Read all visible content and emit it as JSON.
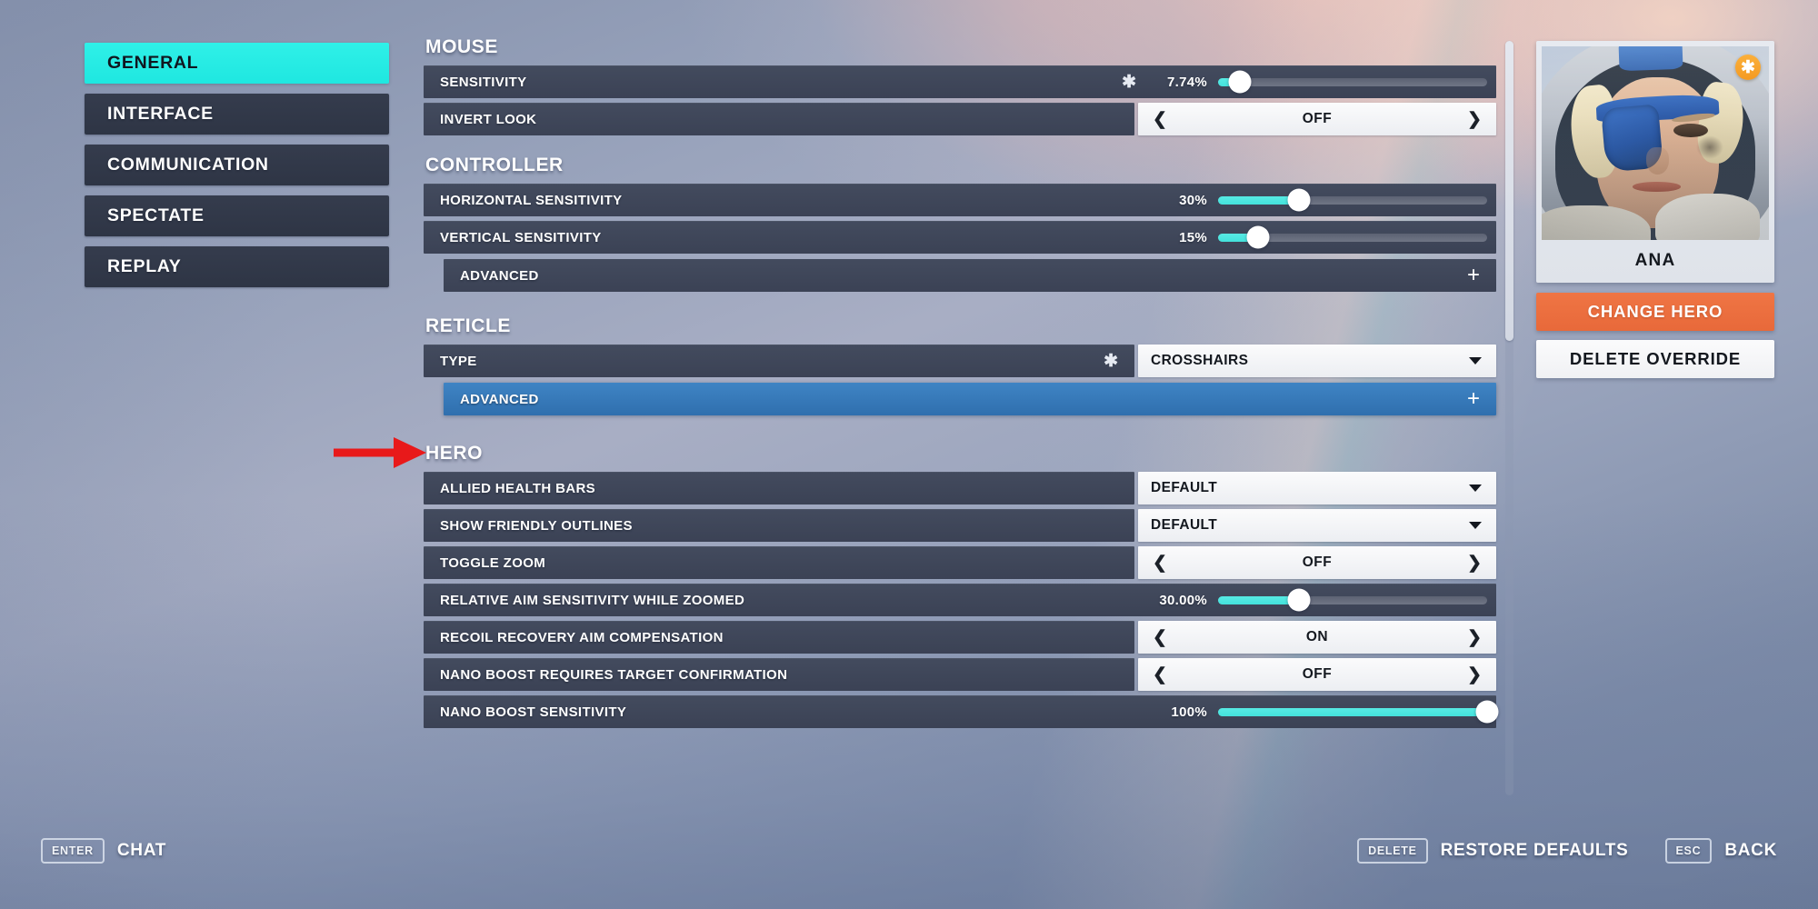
{
  "sidebar": {
    "items": [
      {
        "label": "GENERAL",
        "active": true
      },
      {
        "label": "INTERFACE",
        "active": false
      },
      {
        "label": "COMMUNICATION",
        "active": false
      },
      {
        "label": "SPECTATE",
        "active": false
      },
      {
        "label": "REPLAY",
        "active": false
      }
    ]
  },
  "groups": {
    "mouse": {
      "title": "MOUSE",
      "sensitivity": {
        "label": "SENSITIVITY",
        "star": "✱",
        "value": "7.74%",
        "percent": 8
      },
      "invert_look": {
        "label": "INVERT LOOK",
        "value": "OFF",
        "left": "❮",
        "right": "❯"
      }
    },
    "controller": {
      "title": "CONTROLLER",
      "horizontal": {
        "label": "HORIZONTAL SENSITIVITY",
        "value": "30%",
        "percent": 30
      },
      "vertical": {
        "label": "VERTICAL SENSITIVITY",
        "value": "15%",
        "percent": 15
      },
      "advanced": {
        "label": "ADVANCED",
        "expand": "+"
      }
    },
    "reticle": {
      "title": "RETICLE",
      "type": {
        "label": "TYPE",
        "star": "✱",
        "value": "CROSSHAIRS"
      },
      "advanced": {
        "label": "ADVANCED",
        "expand": "+",
        "highlighted": true
      }
    },
    "hero_settings": {
      "title": "HERO",
      "allied_health_bars": {
        "label": "ALLIED HEALTH BARS",
        "value": "DEFAULT"
      },
      "show_friendly_outlines": {
        "label": "SHOW FRIENDLY OUTLINES",
        "value": "DEFAULT"
      },
      "toggle_zoom": {
        "label": "TOGGLE ZOOM",
        "value": "OFF",
        "left": "❮",
        "right": "❯"
      },
      "relative_aim": {
        "label": "RELATIVE AIM SENSITIVITY WHILE ZOOMED",
        "value": "30.00%",
        "percent": 30
      },
      "recoil_recovery": {
        "label": "RECOIL RECOVERY AIM COMPENSATION",
        "value": "ON",
        "left": "❮",
        "right": "❯"
      },
      "nano_confirm": {
        "label": "NANO BOOST REQUIRES TARGET CONFIRMATION",
        "value": "OFF",
        "left": "❮",
        "right": "❯"
      },
      "nano_sensitivity": {
        "label": "NANO BOOST SENSITIVITY",
        "value": "100%",
        "percent": 100
      }
    }
  },
  "hero_panel": {
    "name": "ANA",
    "badge": "✱",
    "change_hero": "CHANGE HERO",
    "delete_override": "DELETE OVERRIDE"
  },
  "footer": {
    "chat_key": "ENTER",
    "chat_label": "CHAT",
    "restore_key": "DELETE",
    "restore_label": "RESTORE DEFAULTS",
    "back_key": "ESC",
    "back_label": "BACK"
  },
  "colors": {
    "accent_cyan": "#2ff0e8",
    "slider_cyan": "#57eae4",
    "highlight_blue": "#3f84c4",
    "orange": "#ef7544",
    "row_dark": "#434b5e",
    "badge_orange": "#fbb03b",
    "annotation_red": "#e8191a"
  }
}
